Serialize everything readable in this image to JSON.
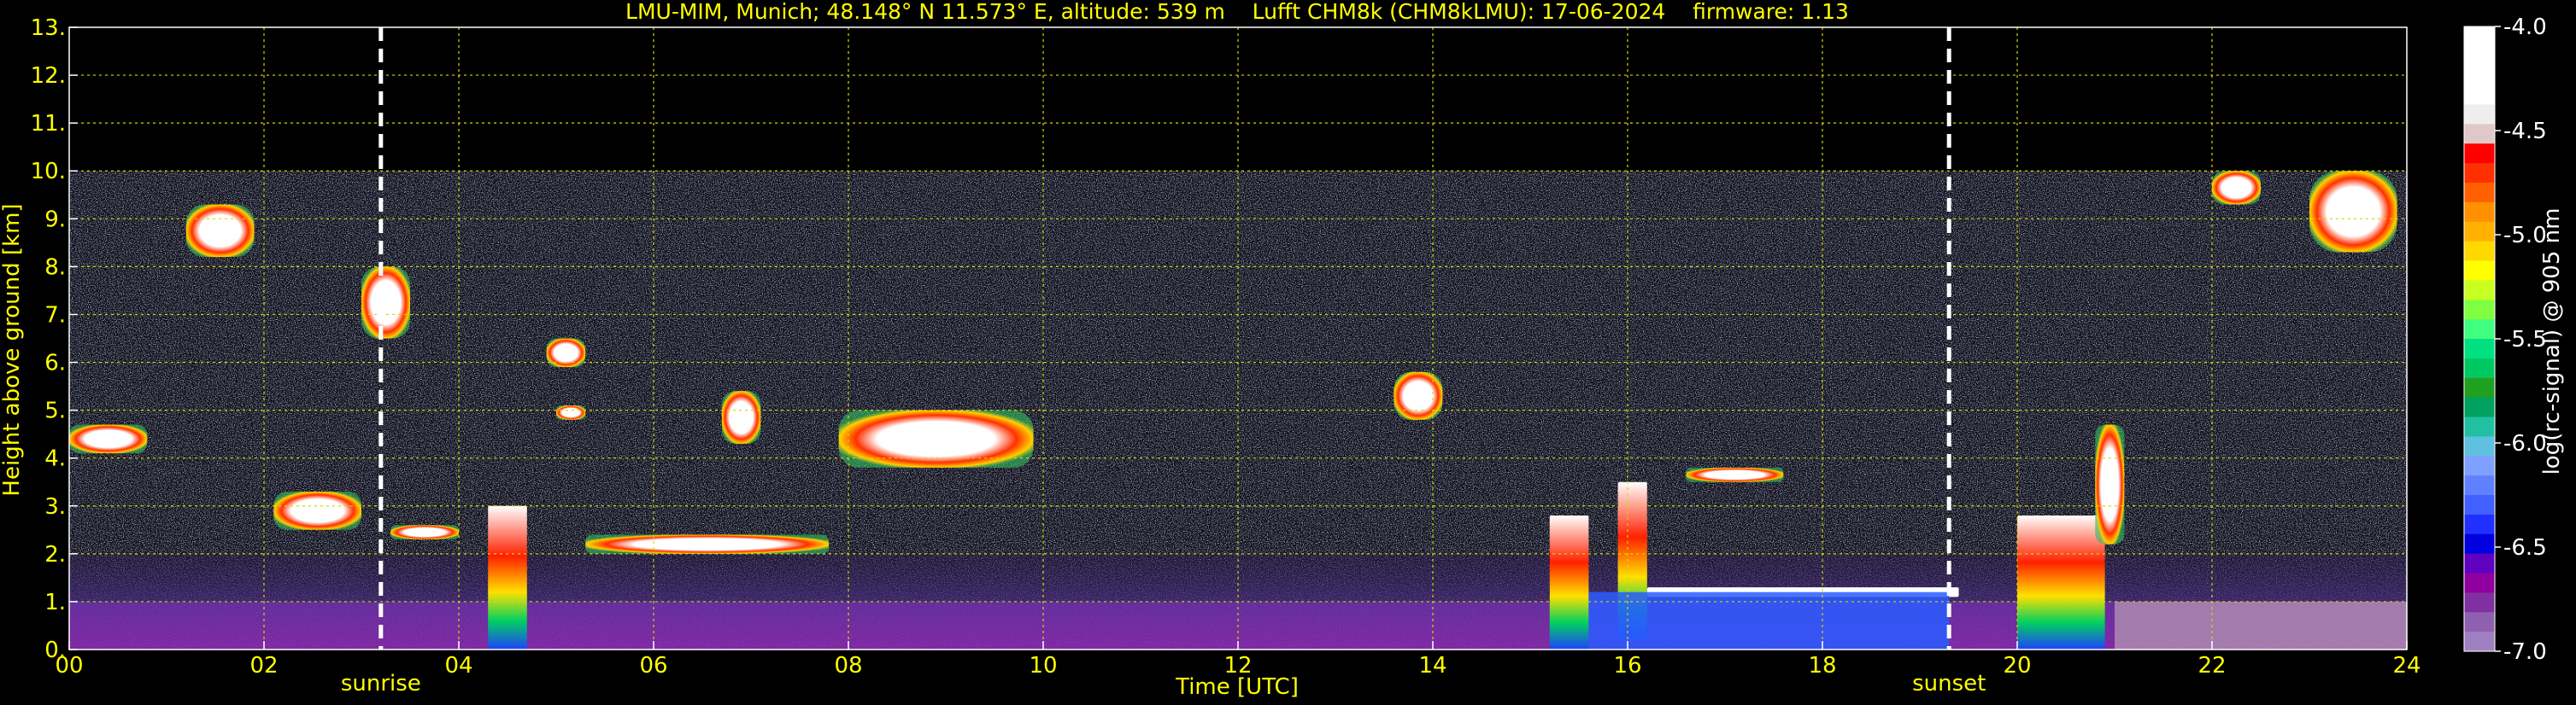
{
  "chart_data": {
    "type": "heatmap",
    "title": "LMU-MIM, Munich; 48.148° N 11.573° E, altitude: 539 m    Lufft CHM8k (CHM8kLMU): 17-06-2024    firmware: 1.13",
    "xlabel": "Time [UTC]",
    "ylabel": "Height above ground [km]",
    "xlim": [
      0,
      24
    ],
    "ylim": [
      0,
      13
    ],
    "x_ticks": [
      0,
      2,
      4,
      6,
      8,
      10,
      12,
      14,
      16,
      18,
      20,
      22,
      24
    ],
    "x_tick_labels": [
      "00",
      "02",
      "04",
      "06",
      "08",
      "10",
      "12",
      "14",
      "16",
      "18",
      "20",
      "22",
      "24"
    ],
    "y_ticks": [
      0,
      1,
      2,
      3,
      4,
      5,
      6,
      7,
      8,
      9,
      10,
      11,
      12,
      13
    ],
    "y_tick_labels": [
      "0.",
      "1.",
      "2.",
      "3.",
      "4.",
      "5.",
      "6.",
      "7.",
      "8.",
      "9.",
      "10.",
      "11.",
      "12.",
      "13."
    ],
    "grid": true,
    "data_ceiling_km": 10,
    "markers": [
      {
        "label": "sunrise",
        "x": 3.2
      },
      {
        "label": "sunset",
        "x": 19.3
      }
    ],
    "colorbar": {
      "label": "log(rc-signal) @ 905 nm",
      "range": [
        -7.0,
        -4.0
      ],
      "ticks": [
        -4.0,
        -4.5,
        -5.0,
        -5.5,
        -6.0,
        -6.5,
        -7.0
      ],
      "tick_labels": [
        "-4.0",
        "-4.5",
        "-5.0",
        "-5.5",
        "-6.0",
        "-6.5",
        "-7.0"
      ],
      "colors": [
        "#ffffff",
        "#ffffff",
        "#ffffff",
        "#ffffff",
        "#eeeeee",
        "#e0c8c8",
        "#ff0000",
        "#ff3000",
        "#ff6000",
        "#ff9000",
        "#ffb000",
        "#ffd800",
        "#ffff00",
        "#c8ff20",
        "#80ff40",
        "#40ff80",
        "#00e080",
        "#00c860",
        "#20a020",
        "#00a060",
        "#20c0a0",
        "#60c0e0",
        "#80a0ff",
        "#6080ff",
        "#4060ff",
        "#2030ff",
        "#0000e0",
        "#6000c0",
        "#9000a0",
        "#8030a0",
        "#9060b0",
        "#a080c0"
      ]
    },
    "features": [
      {
        "name": "near-surface aerosol layer",
        "x": [
          0,
          24
        ],
        "y": [
          0,
          1.0
        ],
        "level": -6.2
      },
      {
        "name": "residual layer",
        "x": [
          0,
          24
        ],
        "y": [
          1.0,
          2.0
        ],
        "level": -6.4
      },
      {
        "name": "cloud",
        "x": [
          0,
          0.8
        ],
        "y": [
          4.1,
          4.7
        ],
        "level": -4.8
      },
      {
        "name": "cloud",
        "x": [
          1.2,
          1.9
        ],
        "y": [
          8.2,
          9.3
        ],
        "level": -5.0
      },
      {
        "name": "cloud",
        "x": [
          3.0,
          3.5
        ],
        "y": [
          6.5,
          8.0
        ],
        "level": -5.0
      },
      {
        "name": "cloud",
        "x": [
          2.1,
          3.0
        ],
        "y": [
          2.5,
          3.3
        ],
        "level": -4.6
      },
      {
        "name": "cloud",
        "x": [
          3.3,
          4.0
        ],
        "y": [
          2.3,
          2.6
        ],
        "level": -4.5
      },
      {
        "name": "convective plume",
        "x": [
          4.3,
          4.7
        ],
        "y": [
          0,
          3.0
        ],
        "level": -4.6
      },
      {
        "name": "cloud",
        "x": [
          4.9,
          5.3
        ],
        "y": [
          5.9,
          6.5
        ],
        "level": -4.8
      },
      {
        "name": "cloud",
        "x": [
          5.0,
          5.3
        ],
        "y": [
          4.8,
          5.1
        ],
        "level": -4.8
      },
      {
        "name": "cloud",
        "x": [
          6.7,
          7.1
        ],
        "y": [
          4.3,
          5.4
        ],
        "level": -4.2
      },
      {
        "name": "cloud",
        "x": [
          7.9,
          9.9
        ],
        "y": [
          3.8,
          5.0
        ],
        "level": -4.2
      },
      {
        "name": "cloud",
        "x": [
          5.3,
          7.8
        ],
        "y": [
          2.0,
          2.4
        ],
        "level": -4.3
      },
      {
        "name": "cloud",
        "x": [
          13.6,
          14.1
        ],
        "y": [
          4.8,
          5.8
        ],
        "level": -4.5
      },
      {
        "name": "convective plume",
        "x": [
          15.2,
          15.6
        ],
        "y": [
          0,
          2.8
        ],
        "level": -4.3
      },
      {
        "name": "convective plume",
        "x": [
          15.9,
          16.2
        ],
        "y": [
          0.2,
          3.5
        ],
        "level": -4.6
      },
      {
        "name": "cloud",
        "x": [
          16.6,
          17.6
        ],
        "y": [
          3.5,
          3.8
        ],
        "level": -4.4
      },
      {
        "name": "boundary layer top",
        "x": [
          16.2,
          19.4
        ],
        "y": [
          1.1,
          1.3
        ],
        "level": -4.3
      },
      {
        "name": "convective plume",
        "x": [
          20.0,
          20.9
        ],
        "y": [
          0,
          2.8
        ],
        "level": -4.5
      },
      {
        "name": "cloud",
        "x": [
          20.8,
          21.1
        ],
        "y": [
          2.2,
          4.7
        ],
        "level": -4.6
      },
      {
        "name": "cirrus",
        "x": [
          23.0,
          23.9
        ],
        "y": [
          8.3,
          10.0
        ],
        "level": -4.8
      },
      {
        "name": "cirrus",
        "x": [
          22.0,
          22.5
        ],
        "y": [
          9.3,
          10.0
        ],
        "level": -5.0
      }
    ]
  }
}
